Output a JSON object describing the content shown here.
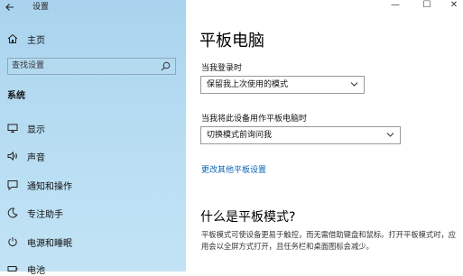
{
  "window": {
    "title": "设置",
    "minimize": "—",
    "maximize": "☐",
    "close": "✕"
  },
  "sidebar": {
    "home": "主页",
    "search_placeholder": "查找设置",
    "section": "系统",
    "items": [
      {
        "label": "显示",
        "icon": "display-icon"
      },
      {
        "label": "声音",
        "icon": "sound-icon"
      },
      {
        "label": "通知和操作",
        "icon": "notification-icon"
      },
      {
        "label": "专注助手",
        "icon": "focus-assist-icon"
      },
      {
        "label": "电源和睡眠",
        "icon": "power-icon"
      },
      {
        "label": "电池",
        "icon": "battery-icon"
      }
    ]
  },
  "main": {
    "title": "平板电脑",
    "signin_label": "当我登录时",
    "signin_value": "保留我上次使用的模式",
    "switch_label": "当我将此设备用作平板电脑时",
    "switch_value": "切换模式前询问我",
    "more_link": "更改其他平板设置",
    "what_title": "什么是平板模式?",
    "what_text": "平板模式可使设备更易于触控，而无需借助键盘和鼠标。打开平板模式时，应用会以全屏方式打开，且任务栏和桌面图标会减少。"
  }
}
